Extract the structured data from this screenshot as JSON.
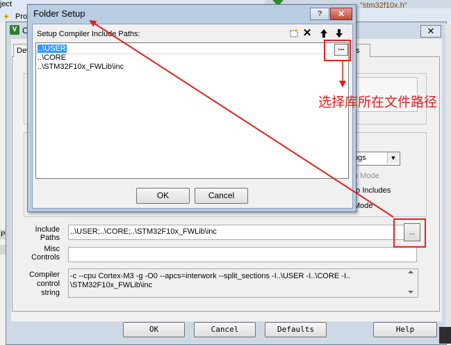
{
  "background": {
    "project_label": "ject",
    "project_item": "Pro",
    "top_right_text": "\"stm32f10x.h\"",
    "window_title": "C",
    "close_glyph": "✕",
    "tab_device": "Dev",
    "tab_right": "s",
    "panel_colon": ":",
    "combo_value": "ngs",
    "option1": "b Mode",
    "option2": "to Includes",
    "option3": "Mode",
    "include_paths_label": "Include\nPaths",
    "include_paths_value": "..\\USER;..\\CORE;..\\STM32F10x_FWLib\\inc",
    "include_browse": "...",
    "misc_controls_label": "Misc\nControls",
    "misc_controls_value": "",
    "compiler_control_label": "Compiler\ncontrol\nstring",
    "compiler_control_value": "-c --cpu Cortex-M3 -g -O0 --apcs=interwork --split_sections -I..\\USER -I..\\CORE -I..\n\\STM32F10x_FWLib\\inc",
    "left_edge_letter": "P",
    "buttons": {
      "ok": "OK",
      "cancel": "Cancel",
      "defaults": "Defaults",
      "help": "Help"
    }
  },
  "folder_setup": {
    "title": "Folder Setup",
    "help_glyph": "?",
    "close_glyph": "✕",
    "list_label": "Setup Compiler Include Paths:",
    "toolbar": {
      "new_icon": "new-folder-icon",
      "delete": "✕",
      "up": "🡡",
      "down": "🡣"
    },
    "paths": [
      "..\\USER",
      "..\\CORE",
      "..\\STM32F10x_FWLib\\inc"
    ],
    "browse_label": "...",
    "ok": "OK",
    "cancel": "Cancel"
  },
  "annotation": {
    "text": "选择库所在文件路径",
    "color": "#e02020"
  },
  "colors": {
    "selection": "#3399ff",
    "dialog_frame": "#b9cde3"
  }
}
